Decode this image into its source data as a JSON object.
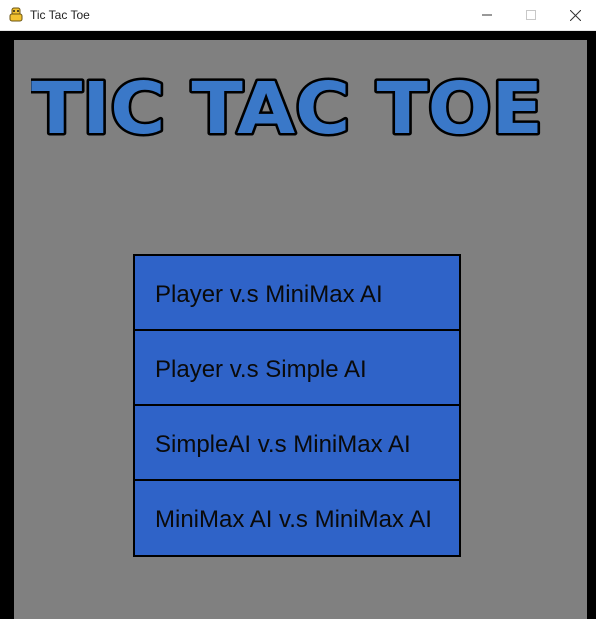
{
  "window": {
    "title": "Tic Tac Toe",
    "icon": "python-snake-icon",
    "controls": [
      "minimize-icon",
      "maximize-icon",
      "close-icon"
    ]
  },
  "game": {
    "logo_text": "TIC TAC TOE",
    "colors": {
      "background": "#808080",
      "border": "#000000",
      "logo_fill": "#3a78c8",
      "logo_outline": "#000000",
      "button_fill": "#2f63c8",
      "button_text": "#0a0a0a"
    },
    "menu": [
      {
        "label": "Player v.s MiniMax AI"
      },
      {
        "label": "Player v.s Simple AI"
      },
      {
        "label": "SimpleAI v.s MiniMax AI"
      },
      {
        "label": "MiniMax AI v.s MiniMax AI"
      }
    ]
  }
}
